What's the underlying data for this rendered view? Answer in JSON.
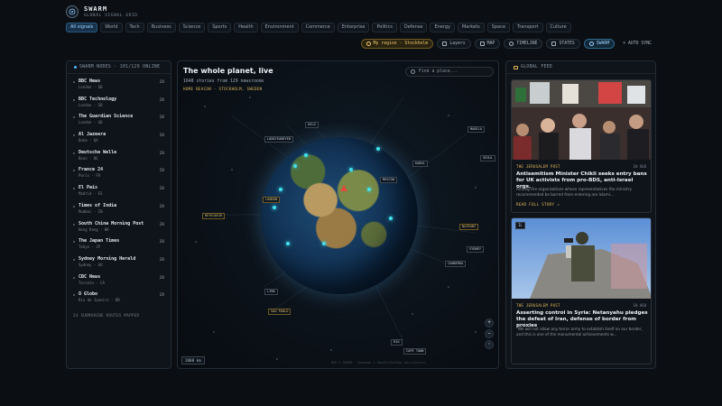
{
  "app": {
    "name": "SWARM",
    "subtitle": "GLOBAL SIGNAL GRID"
  },
  "categories": [
    "All signals",
    "World",
    "Tech",
    "Business",
    "Science",
    "Sports",
    "Health",
    "Environment",
    "Commerce",
    "Enterprise",
    "Politics",
    "Defense",
    "Energy",
    "Markets",
    "Space",
    "Transport",
    "Culture"
  ],
  "toolbar": {
    "region": "My region · Stockholm",
    "layers": "Layers",
    "map": "MAP",
    "timeline": "TIMELINE",
    "states": "STATES",
    "swarm": "SWARM",
    "autosync": "+ AUTO SYNC"
  },
  "nodes_panel": {
    "title": "SWARM NODES · 101/129 ONLINE",
    "footer": "24 SUBMARINE ROUTES MAPPED",
    "items": [
      {
        "name": "BBC News",
        "loc": "London · GB",
        "count": "28"
      },
      {
        "name": "BBC Technology",
        "loc": "London · GB",
        "count": "28"
      },
      {
        "name": "The Guardian Science",
        "loc": "London · GB",
        "count": "28"
      },
      {
        "name": "Al Jazeera",
        "loc": "Doha · QA",
        "count": "28"
      },
      {
        "name": "Deutsche Welle",
        "loc": "Bonn · DE",
        "count": "28"
      },
      {
        "name": "France 24",
        "loc": "Paris · FR",
        "count": "28"
      },
      {
        "name": "El País",
        "loc": "Madrid · ES",
        "count": "28"
      },
      {
        "name": "Times of India",
        "loc": "Mumbai · IN",
        "count": "28"
      },
      {
        "name": "South China Morning Post",
        "loc": "Hong Kong · HK",
        "count": "28"
      },
      {
        "name": "The Japan Times",
        "loc": "Tokyo · JP",
        "count": "28"
      },
      {
        "name": "Sydney Morning Herald",
        "loc": "Sydney · AU",
        "count": "28"
      },
      {
        "name": "CBC News",
        "loc": "Toronto · CA",
        "count": "28"
      },
      {
        "name": "O Globo",
        "loc": "Rio de Janeiro · BR",
        "count": "28"
      }
    ]
  },
  "map": {
    "title": "The whole planet, live",
    "subtitle": "1648 stories from 129 newsrooms",
    "home": "HOME BEACON · STOCKHOLM, SWEDEN",
    "search_placeholder": "Find a place...",
    "scale": "2000 km",
    "zoom_in": "+",
    "zoom_out": "−",
    "attribution": "MAP © SWARM · Basemap © OpenStreetMap contributors",
    "cities": {
      "c1": "OSLO",
      "c2": "LONGYEARBYEN",
      "c3": "LONDON",
      "c4": "REYKJAVIK",
      "c5": "KABUL",
      "c6": "MANILA",
      "c7": "NAIROBI",
      "c8": "LIMA",
      "c9": "SEOUL",
      "c10": "SAO PAULO",
      "c11": "CANBERRA",
      "c12": "SYDNEY",
      "c13": "CAPE TOWN",
      "c14": "MOSCOW",
      "c15": "RIO"
    }
  },
  "feed": {
    "title": "GLOBAL FEED",
    "cards": [
      {
        "source": "THE JERUSALEM POST",
        "age": "1H AGO",
        "headline": "Antisemitism Minister Chikli seeks entry bans for UK activists from pro-BDS, anti-Israel orgs.",
        "lede": "Among the organizations whose representatives the ministry recommended be barred from entering are Islami...",
        "readmore": "READ FULL STORY ↗"
      },
      {
        "badge": "IL",
        "source": "THE JERUSALEM POST",
        "age": "1H AGO",
        "headline": "Asserting control in Syria: Netanyahu pledges the defeat of Iran, defense of border from proxies",
        "lede": "\"We will not allow any terror army to establish itself on our border, and this is one of the monumental achievements w..."
      }
    ]
  }
}
